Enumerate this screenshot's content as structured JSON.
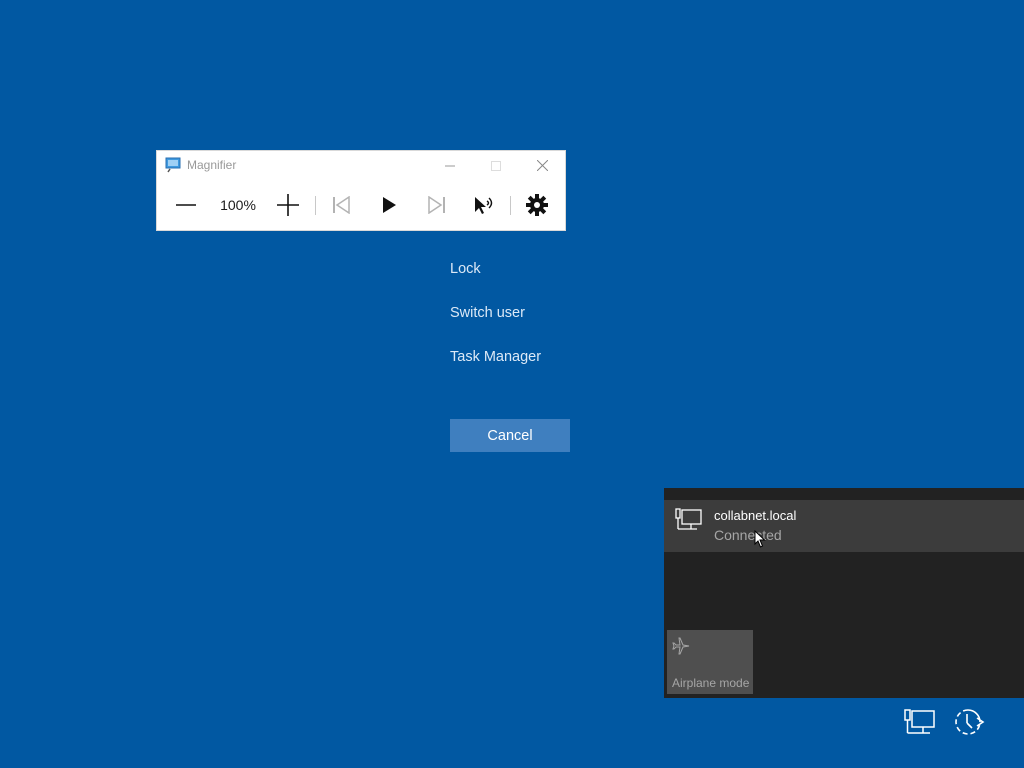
{
  "magnifier": {
    "title": "Magnifier",
    "zoom_level": "100%",
    "icons": {
      "app": "magnifier-app-icon",
      "minimize": "minimize-icon",
      "maximize": "maximize-icon",
      "close": "close-icon",
      "zoom_out": "minus-icon",
      "zoom_in": "plus-icon",
      "previous": "skip-previous-icon",
      "play": "play-icon",
      "next": "skip-next-icon",
      "read_from_here": "read-from-here-icon",
      "settings": "gear-icon"
    }
  },
  "options": {
    "lock": "Lock",
    "switch_user": "Switch user",
    "task_manager": "Task Manager",
    "cancel": "Cancel"
  },
  "network_flyout": {
    "network_name": "collabnet.local",
    "network_status": "Connected",
    "airplane_mode_label": "Airplane mode"
  },
  "colors": {
    "desktop_background": "#0158a2",
    "flyout_background": "#222222",
    "cancel_button": "#3f7fbf"
  }
}
